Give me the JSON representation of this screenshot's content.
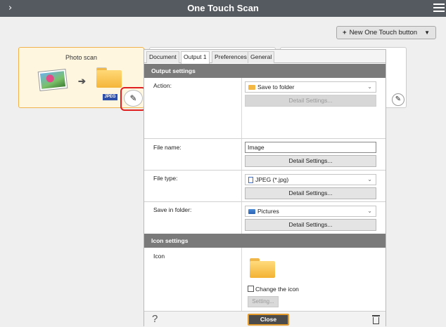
{
  "window": {
    "title": "One Touch Scan"
  },
  "toolbar": {
    "new_button_label": "New One Touch button"
  },
  "card": {
    "label": "Photo scan",
    "badge": "JPEG"
  },
  "dialog": {
    "tabs": [
      {
        "label": "Document"
      },
      {
        "label": "Output 1"
      },
      {
        "label": "Preferences"
      },
      {
        "label": "General"
      }
    ],
    "active_tab": "Output 1",
    "output_section_title": "Output settings",
    "action": {
      "label": "Action:",
      "value": "Save to folder",
      "detail_button": "Detail Settings..."
    },
    "file_name": {
      "label": "File name:",
      "value": "Image",
      "detail_button": "Detail Settings..."
    },
    "file_type": {
      "label": "File type:",
      "value": "JPEG (*.jpg)",
      "detail_button": "Detail Settings..."
    },
    "save_in": {
      "label": "Save in folder:",
      "value": "Pictures",
      "detail_button": "Detail Settings..."
    },
    "icon_section_title": "Icon settings",
    "icon": {
      "label": "Icon",
      "change_label": "Change the icon",
      "change_checked": false,
      "setting_button": "Setting..."
    },
    "footer": {
      "help": "?",
      "close_label": "Close"
    }
  }
}
